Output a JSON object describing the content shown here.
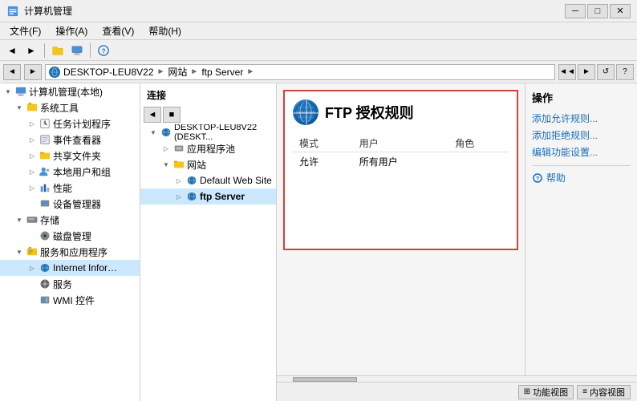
{
  "window": {
    "title": "计算机管理",
    "min_btn": "─",
    "max_btn": "□",
    "close_btn": "✕"
  },
  "menu": {
    "items": [
      "文件(F)",
      "操作(A)",
      "查看(V)",
      "帮助(H)"
    ]
  },
  "toolbar": {
    "back": "◄",
    "forward": "►",
    "up": "↑",
    "help": "?"
  },
  "address": {
    "back": "◄",
    "forward": "►",
    "globe_label": "●",
    "path": [
      "DESKTOP-LEU8V22",
      "网站",
      "ftp Server"
    ],
    "sep": "►",
    "btn1": "◄◄",
    "btn2": "◄◄",
    "btn3": "✕",
    "btn4": "?"
  },
  "tree": {
    "root": "计算机管理(本地)",
    "system_tools": "系统工具",
    "task_scheduler": "任务计划程序",
    "event_viewer": "事件查看器",
    "shared_folders": "共享文件夹",
    "local_users": "本地用户和组",
    "performance": "性能",
    "device_manager": "设备管理器",
    "storage": "存储",
    "disk_mgmt": "磁盘管理",
    "services_apps": "服务和应用程序",
    "iis": "Internet Information S...",
    "services": "服务",
    "wmi": "WMI 控件"
  },
  "connections": {
    "header": "连接",
    "toolbar_btn1": "◄",
    "server": "DESKTOP-LEU8V22 (DESKT...",
    "app_pool": "应用程序池",
    "sites": "网站",
    "default_site": "Default Web Site",
    "ftp_server": "ftp Server"
  },
  "ftp_rules": {
    "title": "FTP 授权规则",
    "col_mode": "模式",
    "col_user": "用户",
    "col_role": "角色",
    "row1_mode": "允许",
    "row1_user": "所有用户",
    "row1_role": ""
  },
  "actions": {
    "header": "操作",
    "add_allow": "添加允许规则...",
    "add_deny": "添加拒绝规则...",
    "edit_features": "编辑功能设置...",
    "help_icon": "?",
    "help_label": "帮助"
  },
  "bottom": {
    "feature_view": "功能视图",
    "content_view": "内容视图",
    "icon1": "⊞",
    "icon2": "≡"
  }
}
